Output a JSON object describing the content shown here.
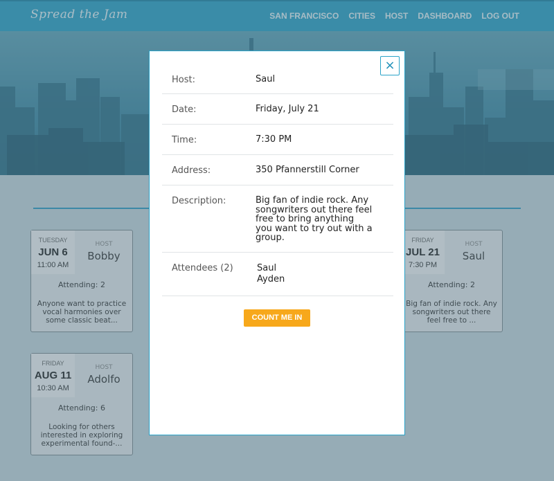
{
  "nav": {
    "brand": "Spread the Jam",
    "links": [
      "SAN FRANCISCO",
      "CITIES",
      "HOST",
      "DASHBOARD",
      "LOG OUT"
    ]
  },
  "cards": [
    {
      "day": "TUESDAY",
      "date": "JUN 6",
      "time": "11:00 AM",
      "host_label": "HOST",
      "host": "Bobby",
      "attending": "Attending: 2",
      "snippet": "Anyone want to practice vocal harmonies over some classic beat..."
    },
    {
      "day": "FRIDAY",
      "date": "JUL 21",
      "time": "7:30 PM",
      "host_label": "HOST",
      "host": "Saul",
      "attending": "Attending: 2",
      "snippet": "Big fan of indie rock. Any songwriters out there feel free to ..."
    },
    {
      "day": "FRIDAY",
      "date": "AUG 11",
      "time": "10:30 AM",
      "host_label": "HOST",
      "host": "Adolfo",
      "attending": "Attending: 6",
      "snippet": "Looking for others interested in exploring experimental found-..."
    }
  ],
  "modal": {
    "close_icon": "×",
    "host_label": "Host:",
    "host": "Saul",
    "date_label": "Date:",
    "date": "Friday, July 21",
    "time_label": "Time:",
    "time": "7:30 PM",
    "address_label": "Address:",
    "address": "350 Pfannerstill Corner",
    "description_label": "Description:",
    "description": "Big fan of indie rock. Any songwriters out there feel free to bring anything you want to try out with a group.",
    "attendees_label": "Attendees (2)",
    "attendees": [
      "Saul",
      "Ayden"
    ],
    "count_me_in": "COUNT ME IN"
  },
  "colors": {
    "accent": "#2aa3c8",
    "button": "#f7a81b",
    "hero": "#3d8aa5"
  }
}
